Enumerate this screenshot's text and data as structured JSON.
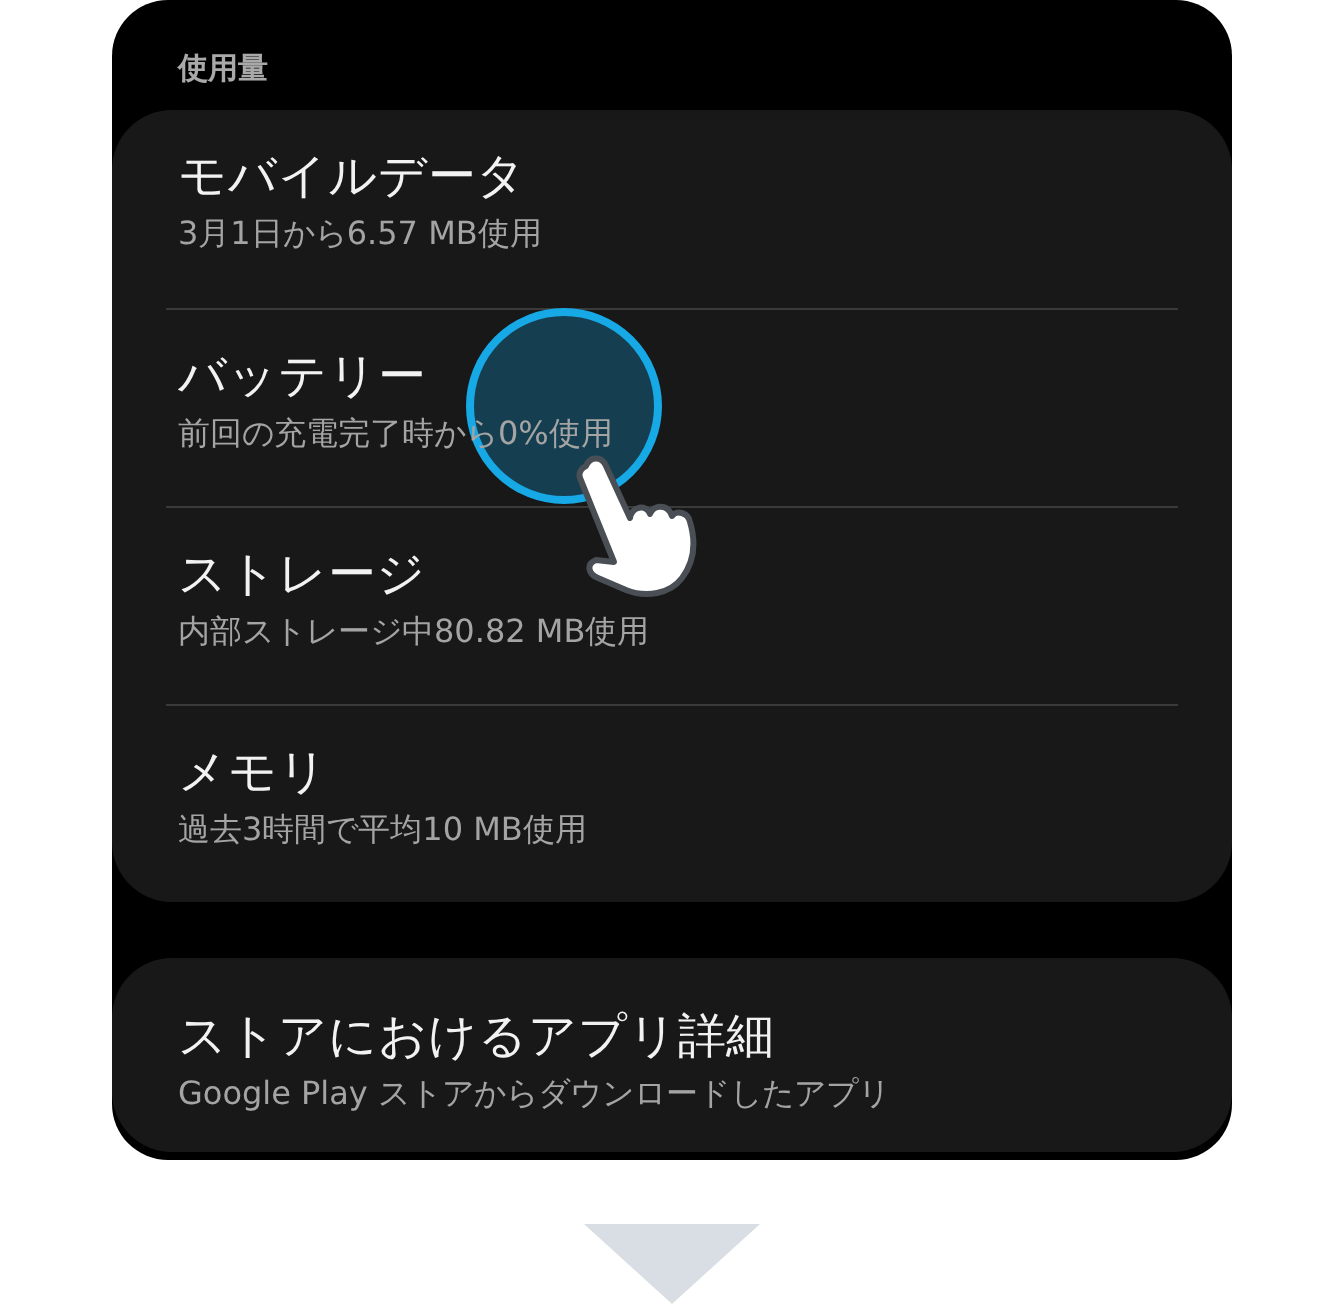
{
  "section_label": "使用量",
  "usage_items": [
    {
      "title": "モバイルデータ",
      "subtitle": "3月1日から6.57 MB使用",
      "tapped": false
    },
    {
      "title": "バッテリー",
      "subtitle": "前回の充電完了時から0%使用",
      "tapped": true
    },
    {
      "title": "ストレージ",
      "subtitle": "内部ストレージ中80.82 MB使用",
      "tapped": false
    },
    {
      "title": "メモリ",
      "subtitle": "過去3時間で平均10 MB使用",
      "tapped": false
    }
  ],
  "store_item": {
    "title": "ストアにおけるアプリ詳細",
    "subtitle": "Google Play ストアからダウンロードしたアプリ"
  }
}
